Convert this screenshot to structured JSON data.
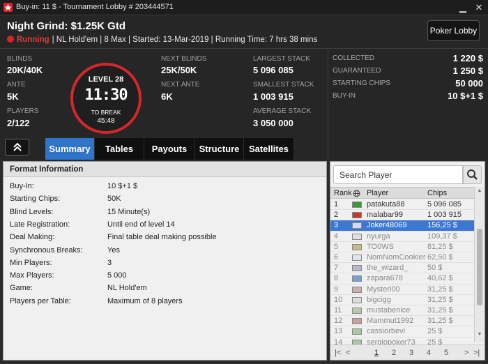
{
  "window": {
    "title": "Buy-in: 11 $ - Tournament Lobby # 203444571",
    "minimize": "▁",
    "close": "✕"
  },
  "header": {
    "name": "Night Grind: $1.25K Gtd",
    "status": "Running",
    "info": "| NL Hold'em | 8 Max | Started: 13-Mar-2019 | Running Time: 7 hrs  38 mins",
    "lobby_button": "Poker Lobby"
  },
  "stats": {
    "blinds_label": "BLINDS",
    "blinds": "20K/40K",
    "ante_label": "ANTE",
    "ante": "5K",
    "players_label": "PLAYERS",
    "players": "2/122",
    "level": "LEVEL 28",
    "clock": "11:30",
    "to_break_label": "TO BREAK",
    "to_break": "45:48",
    "next_blinds_label": "NEXT BLINDS",
    "next_blinds": "25K/50K",
    "next_ante_label": "NEXT ANTE",
    "next_ante": "6K",
    "largest_label": "LARGEST STACK",
    "largest": "5 096 085",
    "smallest_label": "SMALLEST STACK",
    "smallest": "1 003 915",
    "average_label": "AVERAGE STACK",
    "average": "3 050 000"
  },
  "prize": {
    "collected_label": "COLLECTED",
    "collected": "1 220 $",
    "guaranteed_label": "GUARANTEED",
    "guaranteed": "1 250 $",
    "starting_label": "STARTING CHIPS",
    "starting": "50 000",
    "buyin_label": "BUY-IN",
    "buyin": "10 $+1 $"
  },
  "collapse_icon": "chevron-up-double",
  "tabs": [
    "Summary",
    "Tables",
    "Payouts",
    "Structure",
    "Satellites"
  ],
  "format": {
    "title": "Format Information",
    "rows": [
      {
        "k": "Buy-In:",
        "v": "10 $+1 $"
      },
      {
        "k": "Starting Chips:",
        "v": "50K"
      },
      {
        "k": "Blind Levels:",
        "v": "15 Minute(s)"
      },
      {
        "k": "Late Registration:",
        "v": "Until end of level 14"
      },
      {
        "k": "Deal Making:",
        "v": "Final table deal making possible"
      },
      {
        "k": "Synchronous Breaks:",
        "v": "Yes"
      },
      {
        "k": "Min Players:",
        "v": "3"
      },
      {
        "k": "Max Players:",
        "v": "5 000"
      },
      {
        "k": "Game:",
        "v": "NL Hold'em"
      },
      {
        "k": "Players per Table:",
        "v": "Maximum of 8 players"
      }
    ]
  },
  "players": {
    "search_placeholder": "Search Player",
    "headers": {
      "rank": "Rank",
      "player": "Player",
      "chips": "Chips"
    },
    "rows": [
      {
        "rank": "1",
        "name": "patakuta88",
        "chips": "5 096 085",
        "state": "active",
        "flag": "#3a9a3a"
      },
      {
        "rank": "2",
        "name": "malabar99",
        "chips": "1 003 915",
        "state": "active",
        "flag": "#c0392b"
      },
      {
        "rank": "3",
        "name": "Joker48069",
        "chips": "156,25 $",
        "state": "selected",
        "flag": "#d8d8ff"
      },
      {
        "rank": "4",
        "name": "nyurga",
        "chips": "109,37 $",
        "state": "out",
        "flag": "#e0e0e0"
      },
      {
        "rank": "5",
        "name": "TO0WS",
        "chips": "81,25 $",
        "state": "out",
        "flag": "#c7b98a"
      },
      {
        "rank": "6",
        "name": "NomNomCookies",
        "chips": "62,50 $",
        "state": "out",
        "flag": "#dfe6f0"
      },
      {
        "rank": "7",
        "name": "the_wizard_",
        "chips": "50 $",
        "state": "out",
        "flag": "#b7b7c8"
      },
      {
        "rank": "8",
        "name": "zapara678",
        "chips": "40,62 $",
        "state": "out",
        "flag": "#7b9fd0"
      },
      {
        "rank": "9",
        "name": "Mysteri00",
        "chips": "31,25 $",
        "state": "out",
        "flag": "#c9b0b0"
      },
      {
        "rank": "10",
        "name": "bigcigg",
        "chips": "31,25 $",
        "state": "out",
        "flag": "#dcdcdc"
      },
      {
        "rank": "11",
        "name": "mustabenice",
        "chips": "31,25 $",
        "state": "out",
        "flag": "#b9c9b0"
      },
      {
        "rank": "12",
        "name": "Mammut1992",
        "chips": "31,25 $",
        "state": "out",
        "flag": "#c9a0a0"
      },
      {
        "rank": "13",
        "name": "cassiorbevi",
        "chips": "25 $",
        "state": "out",
        "flag": "#a8c8a0"
      },
      {
        "rank": "14",
        "name": "sergiopoker73",
        "chips": "25 $",
        "state": "out",
        "flag": "#a8c8a0"
      }
    ],
    "pages": [
      "1",
      "2",
      "3",
      "4",
      "5"
    ],
    "current_page": "1"
  }
}
